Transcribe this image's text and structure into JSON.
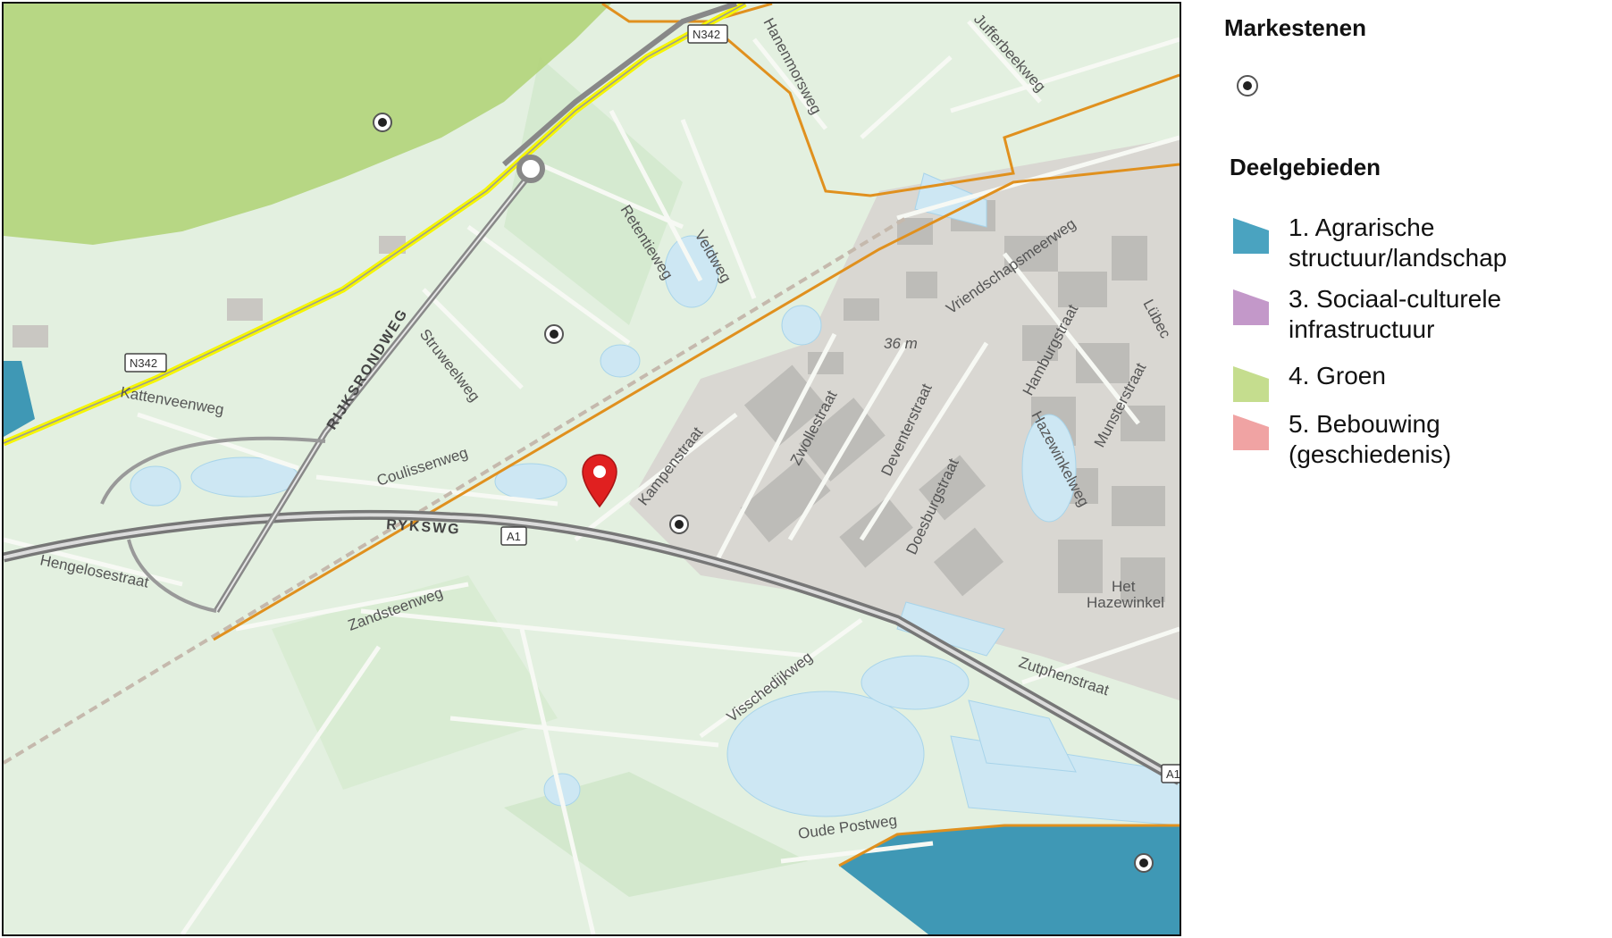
{
  "legend": {
    "markers_title": "Markestenen",
    "areas_title": "Deelgebieden",
    "items": [
      {
        "label": "1. Agrarische structuur/landschap",
        "color": "#4aa3c0"
      },
      {
        "label": "3. Sociaal-culturele infrastructuur",
        "color": "#c398c9"
      },
      {
        "label": "4. Groen",
        "color": "#c5dd8e"
      },
      {
        "label": "5. Bebouwing (geschiedenis)",
        "color": "#f0a3a3"
      }
    ]
  },
  "map": {
    "roads": {
      "rijksweg": "RYKSWG",
      "rijksrondweg": "RIJKSRONDWEG",
      "hanenmorsweg": "Hanenmorsweg",
      "jufferbeekweg": "Jufferbeekweg",
      "retentieweg": "Retentieweg",
      "veldweg": "Veldweg",
      "struweelweg": "Struweelweg",
      "coulissenweg": "Coulissenweg",
      "kattenveenweg": "Kattenveenweg",
      "hengelosestraat": "Hengelosestraat",
      "zandsteenweg": "Zandsteenweg",
      "kampenstraat": "Kampenstraat",
      "zwollestraat": "Zwollestraat",
      "deventerstraat": "Deventerstraat",
      "doesburgstraat": "Doesburgstraat",
      "vriendschapsmeerweg": "Vriendschapsmeerweg",
      "hamburgstraat": "Hamburgstraat",
      "hazewinkelweg": "Hazewinkelweg",
      "lubeck": "Lübec",
      "munsterstraat": "Munsterstraat",
      "zutphenstraat": "Zutphenstraat",
      "visschedijkweg": "Visschedijkweg",
      "oude_postweg": "Oude Postweg"
    },
    "shields": {
      "n342_top": "N342",
      "n342_left": "N342",
      "a1_mid": "A1",
      "a1_right": "A1"
    },
    "elevation": "36 m",
    "place": {
      "line1": "Het",
      "line2": "Hazewinkel"
    },
    "colors": {
      "agrarisch": "#3f98b5",
      "groen": "#b4d57e",
      "pin": "#e02020",
      "boundary": "#e0901e"
    }
  }
}
